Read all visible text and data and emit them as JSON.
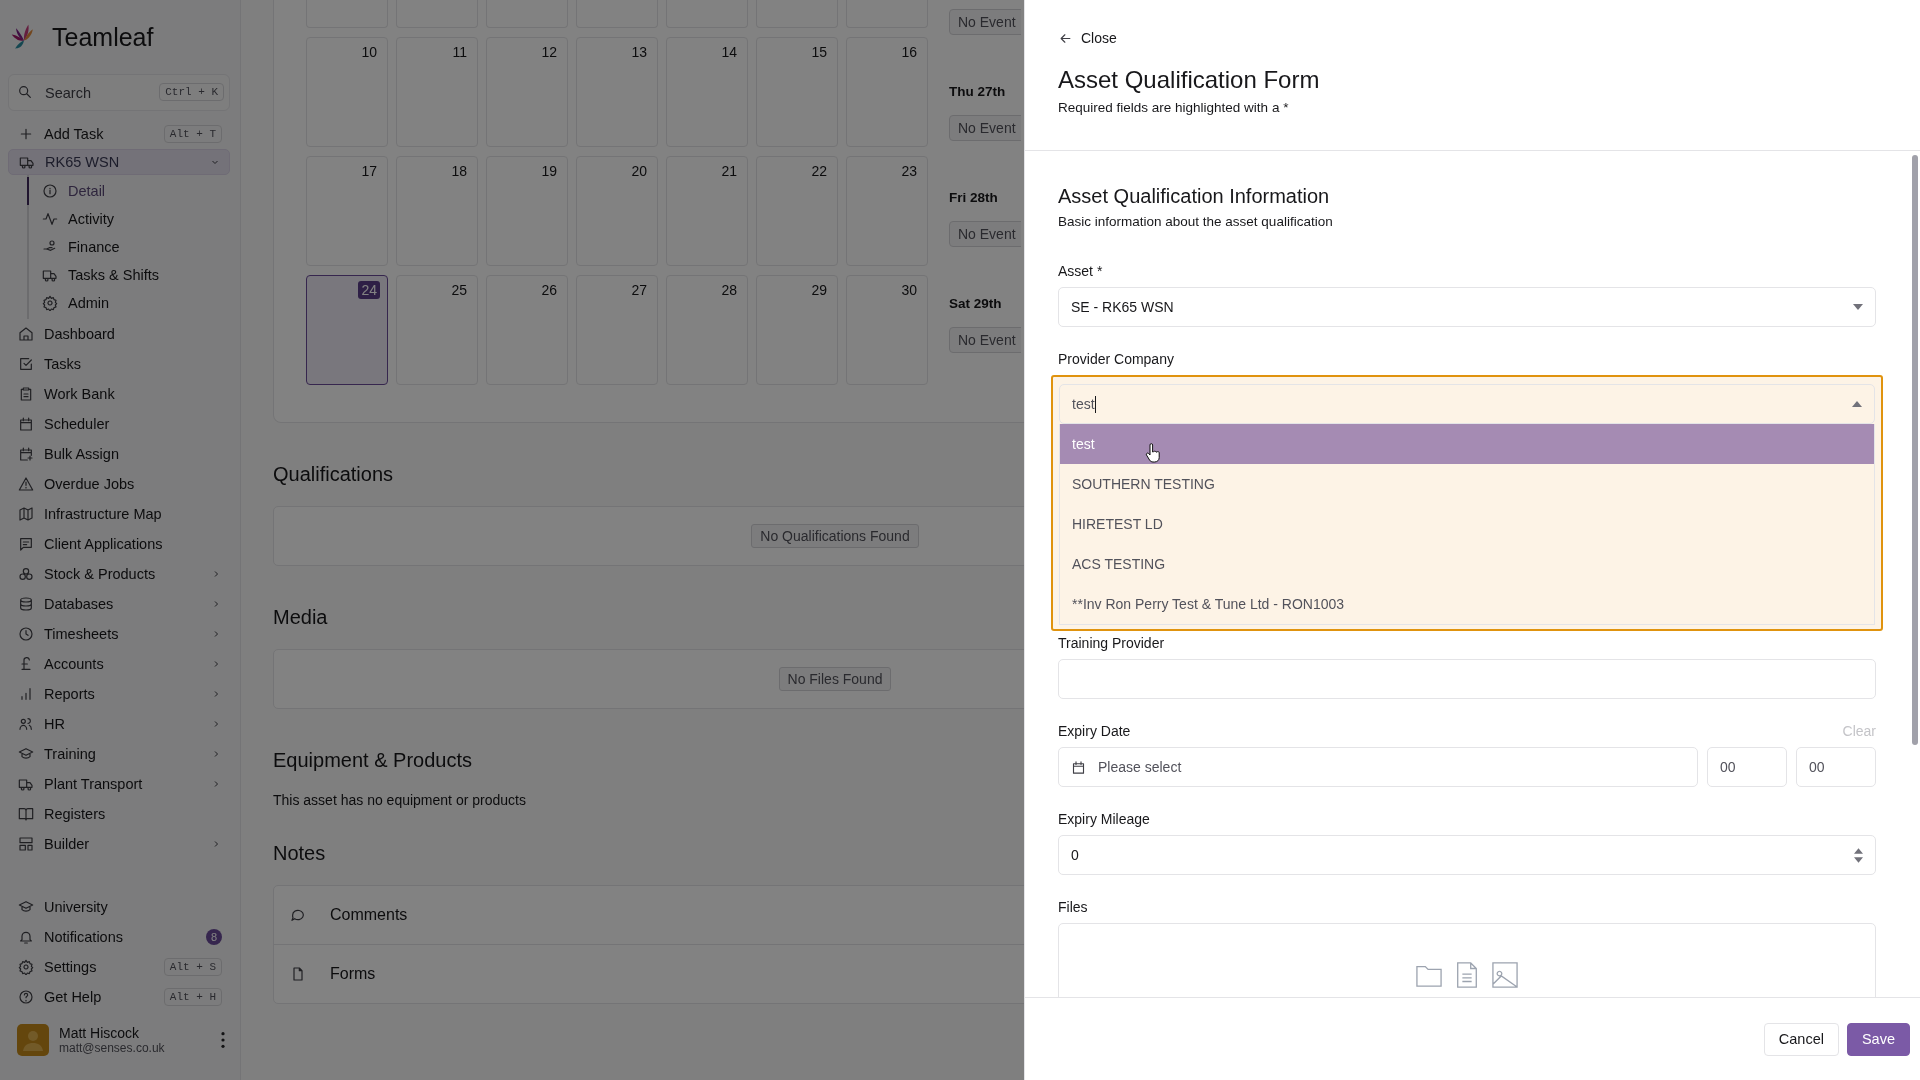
{
  "sidebar": {
    "brand": "Teamleaf",
    "search": {
      "placeholder": "Search",
      "shortcut": "Ctrl + K"
    },
    "add_task": {
      "label": "Add Task",
      "shortcut": "Alt + T"
    },
    "asset": {
      "label": "RK65 WSN",
      "expanded": true,
      "children": [
        {
          "label": "Detail",
          "selected": true
        },
        {
          "label": "Activity",
          "selected": false
        },
        {
          "label": "Finance",
          "selected": false
        },
        {
          "label": "Tasks & Shifts",
          "selected": false
        },
        {
          "label": "Admin",
          "selected": false
        }
      ]
    },
    "nav": [
      {
        "label": "Dashboard",
        "submenu": false
      },
      {
        "label": "Tasks",
        "submenu": false
      },
      {
        "label": "Work Bank",
        "submenu": false
      },
      {
        "label": "Scheduler",
        "submenu": false
      },
      {
        "label": "Bulk Assign",
        "submenu": false
      },
      {
        "label": "Overdue Jobs",
        "submenu": false
      },
      {
        "label": "Infrastructure Map",
        "submenu": false
      },
      {
        "label": "Client Applications",
        "submenu": false
      },
      {
        "label": "Stock & Products",
        "submenu": true
      },
      {
        "label": "Databases",
        "submenu": true
      },
      {
        "label": "Timesheets",
        "submenu": true
      },
      {
        "label": "Accounts",
        "submenu": true
      },
      {
        "label": "Reports",
        "submenu": true
      },
      {
        "label": "HR",
        "submenu": true
      },
      {
        "label": "Training",
        "submenu": true
      },
      {
        "label": "Plant Transport",
        "submenu": true
      },
      {
        "label": "Registers",
        "submenu": false
      },
      {
        "label": "Builder",
        "submenu": true
      }
    ],
    "footer_nav": [
      {
        "label": "University"
      },
      {
        "label": "Notifications",
        "badge": "8"
      },
      {
        "label": "Settings",
        "shortcut": "Alt + S"
      },
      {
        "label": "Get Help",
        "shortcut": "Alt + H"
      }
    ],
    "user": {
      "name": "Matt Hiscock",
      "email": "matt@senses.co.uk"
    }
  },
  "calendar": {
    "weeks": [
      [
        {
          "day": "10",
          "selected": false
        },
        {
          "day": "11",
          "selected": false
        },
        {
          "day": "12",
          "selected": false
        },
        {
          "day": "13",
          "selected": false
        },
        {
          "day": "14",
          "selected": false
        },
        {
          "day": "15",
          "selected": false
        },
        {
          "day": "16",
          "selected": false
        }
      ],
      [
        {
          "day": "17",
          "selected": false
        },
        {
          "day": "18",
          "selected": false
        },
        {
          "day": "19",
          "selected": false
        },
        {
          "day": "20",
          "selected": false
        },
        {
          "day": "21",
          "selected": false
        },
        {
          "day": "22",
          "selected": false
        },
        {
          "day": "23",
          "selected": false
        }
      ],
      [
        {
          "day": "24",
          "selected": true
        },
        {
          "day": "25",
          "selected": false
        },
        {
          "day": "26",
          "selected": false
        },
        {
          "day": "27",
          "selected": false
        },
        {
          "day": "28",
          "selected": false
        },
        {
          "day": "29",
          "selected": false
        },
        {
          "day": "30",
          "selected": false
        }
      ]
    ],
    "agenda": [
      {
        "event": "No Event"
      },
      {
        "heading": "Thu 27th",
        "event": "No Event"
      },
      {
        "heading": "Fri 28th",
        "event": "No Event"
      },
      {
        "heading": "Sat 29th",
        "event": "No Event"
      }
    ]
  },
  "qualifications": {
    "title": "Qualifications",
    "empty": "No Qualifications Found"
  },
  "media": {
    "title": "Media",
    "empty": "No Files Found"
  },
  "equipment": {
    "title": "Equipment & Products",
    "text": "This asset has no equipment or products"
  },
  "notes": {
    "title": "Notes",
    "items": [
      "Comments",
      "Forms"
    ]
  },
  "drawer": {
    "close": "Close",
    "title": "Asset Qualification Form",
    "subtitle": "Required fields are highlighted with a *",
    "section": {
      "title": "Asset Qualification Information",
      "subtitle": "Basic information about the asset qualification"
    },
    "asset": {
      "label": "Asset *",
      "value": "SE - RK65 WSN"
    },
    "provider": {
      "label": "Provider Company",
      "value": "test",
      "open": true,
      "options": [
        {
          "label": "test",
          "selected": true
        },
        {
          "label": "SOUTHERN TESTING",
          "selected": false
        },
        {
          "label": "HIRETEST LD",
          "selected": false
        },
        {
          "label": "ACS TESTING",
          "selected": false
        },
        {
          "label": "**Inv Ron Perry Test & Tune Ltd - RON1003",
          "selected": false
        }
      ]
    },
    "training_provider": {
      "label": "Training Provider"
    },
    "expiry_date": {
      "label": "Expiry Date",
      "clear": "Clear",
      "placeholder": "Please select",
      "hour": "00",
      "minute": "00"
    },
    "expiry_mileage": {
      "label": "Expiry Mileage",
      "value": "0"
    },
    "files": {
      "label": "Files"
    },
    "buttons": {
      "cancel": "Cancel",
      "save": "Save"
    }
  }
}
